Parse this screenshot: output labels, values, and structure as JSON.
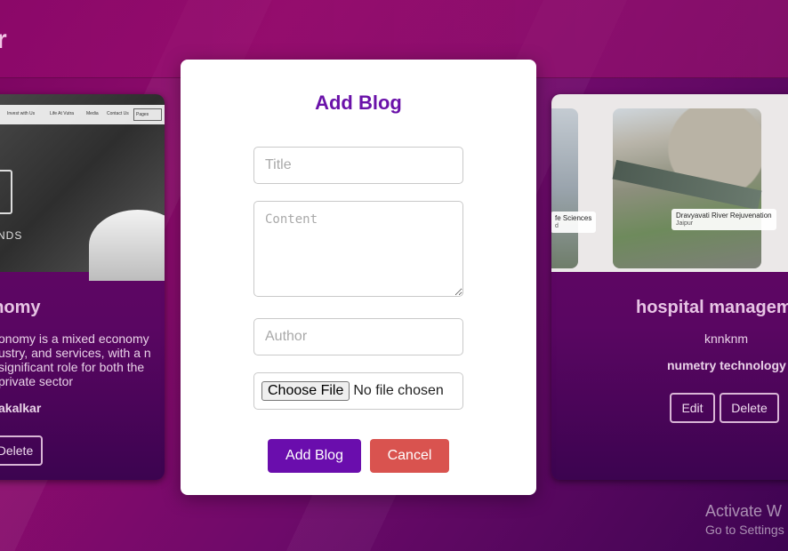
{
  "page": {
    "title_fragment": "r"
  },
  "cards": {
    "left": {
      "title": "onomy",
      "description": "onomy is a mixed economy ustry, and services, with a n significant role for both the private sector",
      "author": "akalkar",
      "delete_label": "Delete",
      "image": {
        "nav_items": [
          "Invest with Us",
          "Life At Vutra",
          "Media",
          "Contact Us"
        ],
        "select_label": "Pages",
        "brand_text": "ANDS"
      }
    },
    "right": {
      "title": "hospital managem",
      "description": "knnknm",
      "author": "numetry technology",
      "edit_label": "Edit",
      "delete_label": "Delete",
      "image": {
        "label_left": "fe Sciences",
        "label_left_sub": "d",
        "label_main": "Dravyavati River Rejuvenation",
        "label_main_sub": "Jaipur"
      }
    }
  },
  "modal": {
    "title": "Add Blog",
    "title_placeholder": "Title",
    "content_placeholder": "Content",
    "author_placeholder": "Author",
    "file_button_label": "Choose File",
    "file_status": "No file chosen",
    "submit_label": "Add Blog",
    "cancel_label": "Cancel"
  },
  "watermark": {
    "line1": "Activate W",
    "line2": "Go to Settings"
  },
  "colors": {
    "accent": "#6a0dad",
    "cancel": "#d9534f",
    "modal_title": "#6a12a9"
  }
}
